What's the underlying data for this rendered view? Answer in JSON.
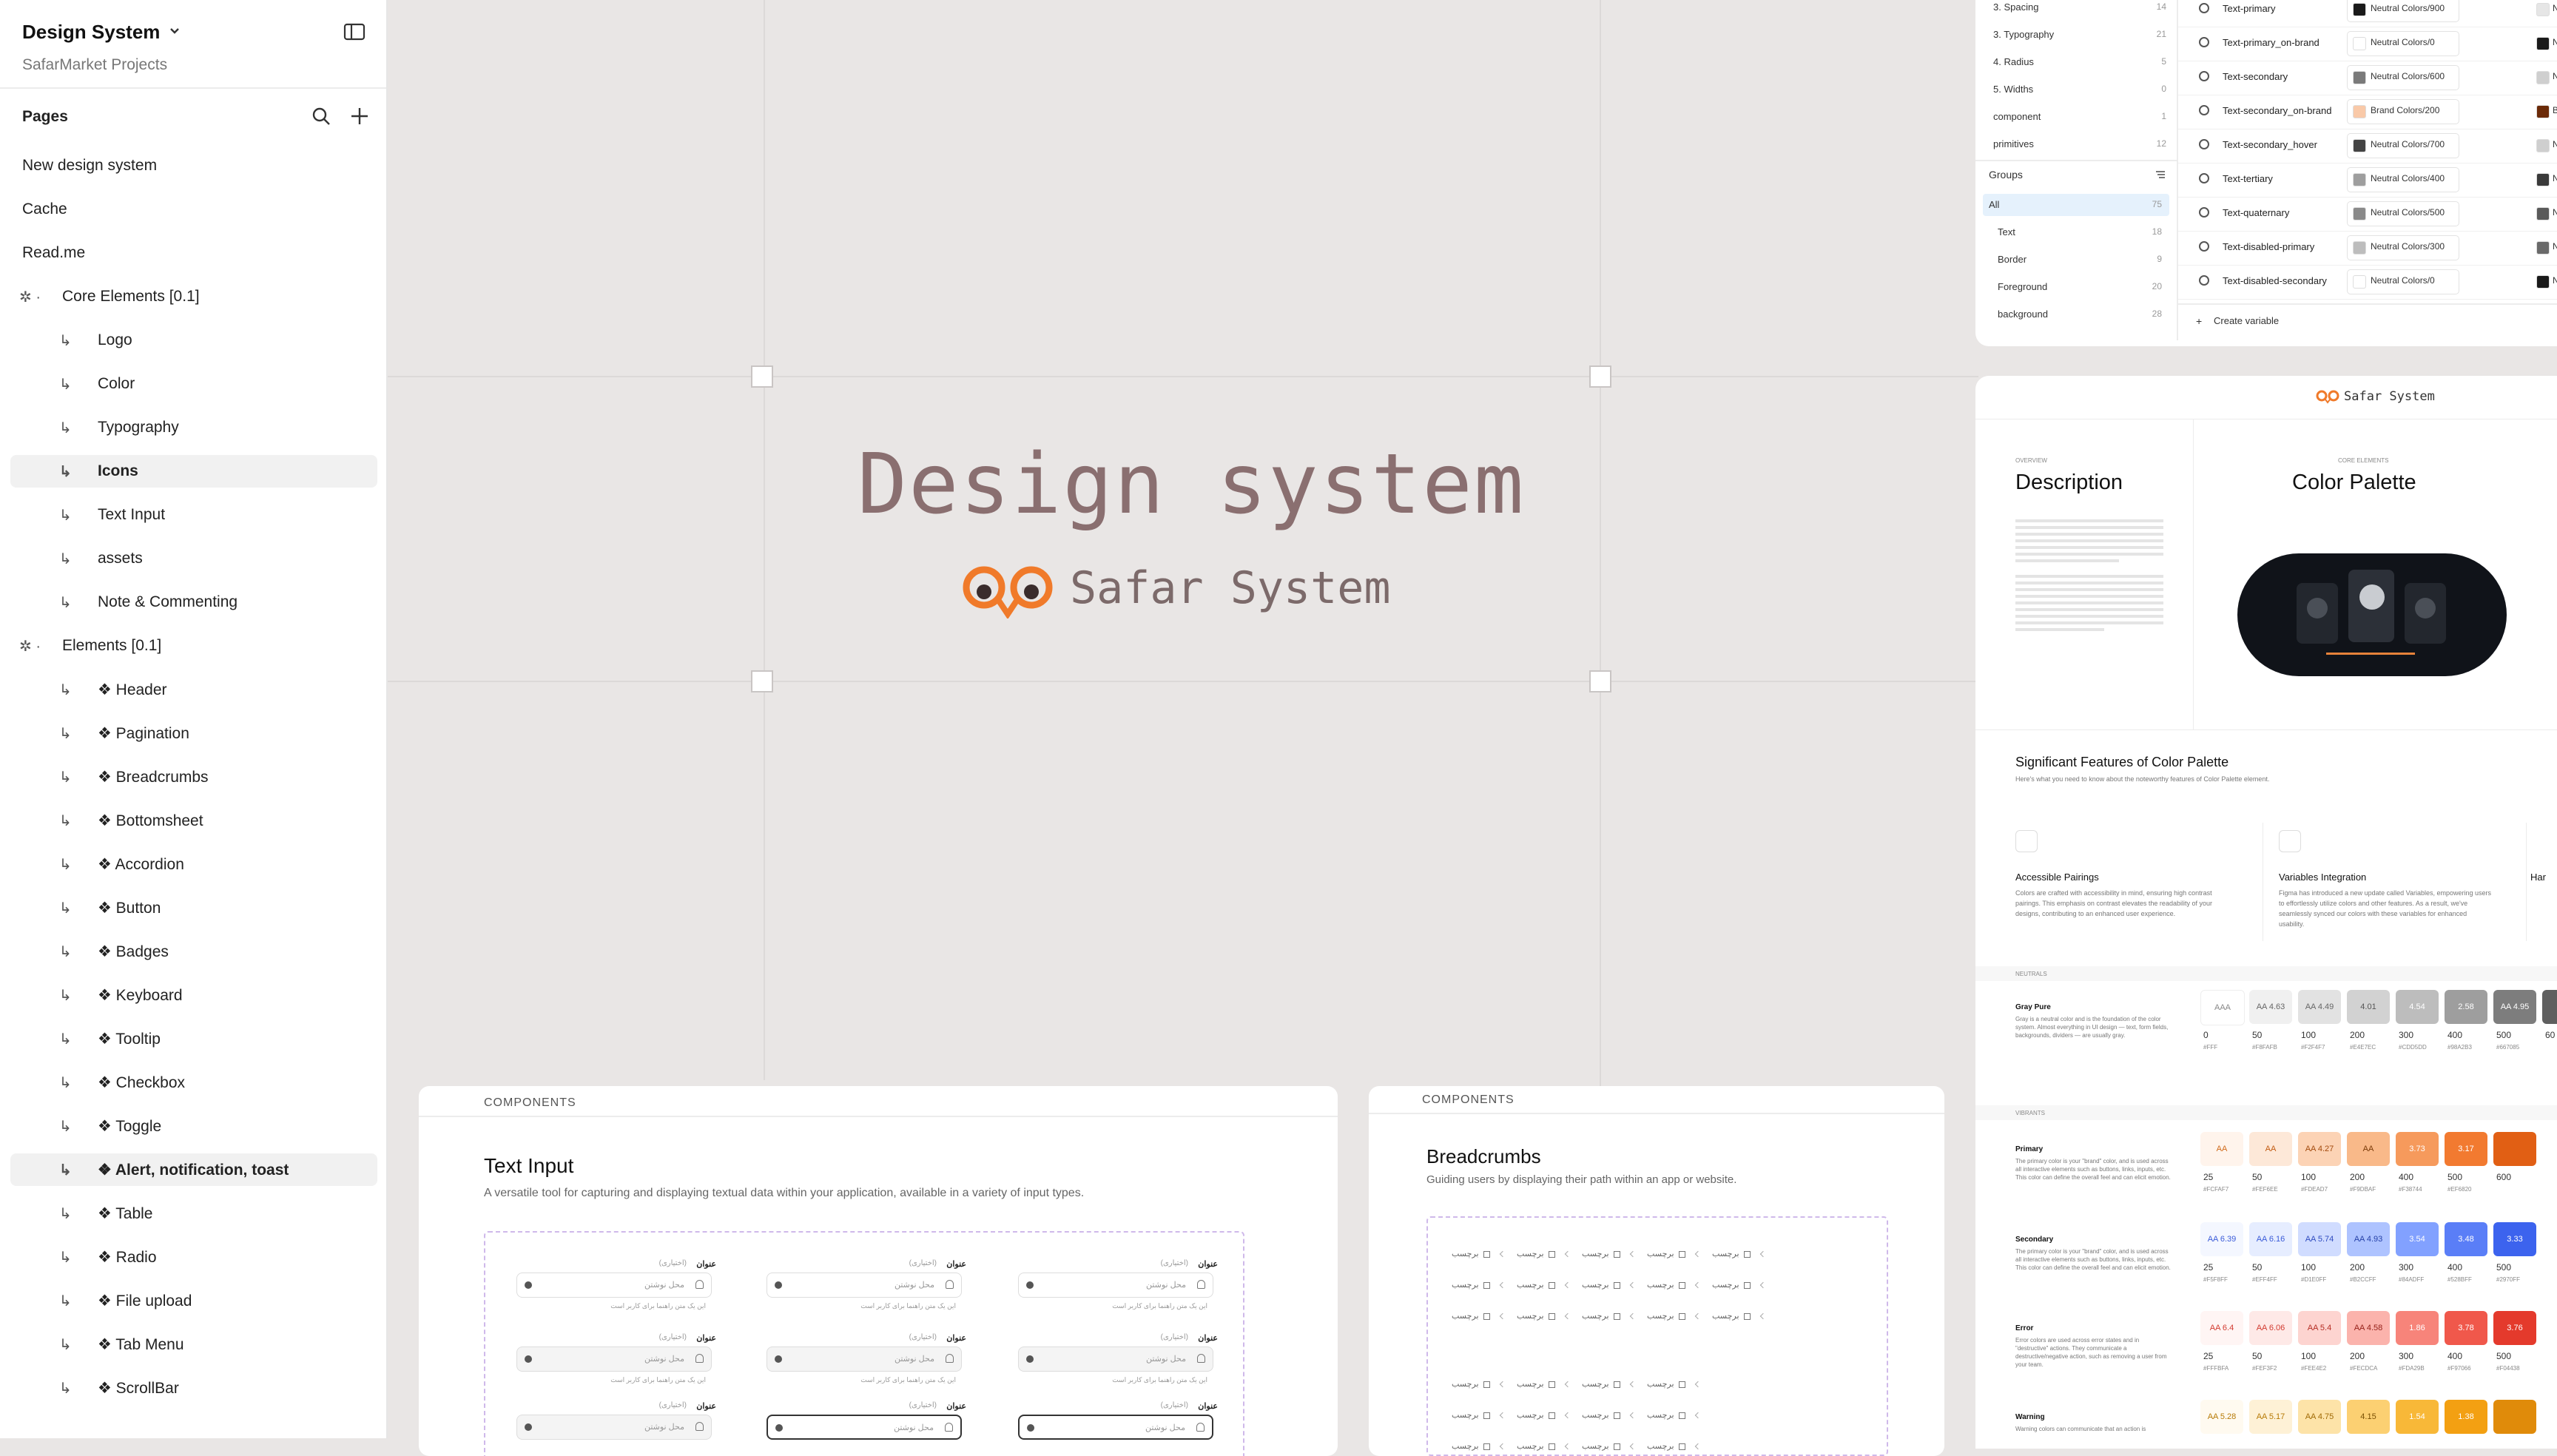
{
  "sidebar": {
    "file_title": "Design System",
    "project": "SafarMarket Projects",
    "pages_label": "Pages",
    "pages": [
      {
        "label": "New design system",
        "prefix": ""
      },
      {
        "label": "Cache",
        "prefix": ""
      },
      {
        "label": "Read.me",
        "prefix": ""
      },
      {
        "label": "Core Elements [0.1]",
        "prefix": "✲ ·"
      },
      {
        "label": "Logo",
        "prefix": "↳"
      },
      {
        "label": "Color",
        "prefix": "↳"
      },
      {
        "label": "Typography",
        "prefix": "↳"
      },
      {
        "label": "Icons",
        "prefix": "↳"
      },
      {
        "label": "Text Input",
        "prefix": "↳"
      },
      {
        "label": "assets",
        "prefix": "↳"
      },
      {
        "label": "Note & Commenting",
        "prefix": "↳"
      },
      {
        "label": "Elements [0.1]",
        "prefix": "✲ ·"
      },
      {
        "label": "❖ Header",
        "prefix": "↳"
      },
      {
        "label": "❖ Pagination",
        "prefix": "↳"
      },
      {
        "label": "❖ Breadcrumbs",
        "prefix": "↳"
      },
      {
        "label": "❖ Bottomsheet",
        "prefix": "↳"
      },
      {
        "label": "❖ Accordion",
        "prefix": "↳"
      },
      {
        "label": "❖ Button",
        "prefix": "↳"
      },
      {
        "label": "❖ Badges",
        "prefix": "↳"
      },
      {
        "label": "❖ Keyboard",
        "prefix": "↳"
      },
      {
        "label": "❖ Tooltip",
        "prefix": "↳"
      },
      {
        "label": "❖ Checkbox",
        "prefix": "↳"
      },
      {
        "label": "❖ Toggle",
        "prefix": "↳"
      },
      {
        "label": "❖ Alert, notification, toast",
        "prefix": "↳"
      },
      {
        "label": "❖ Table",
        "prefix": "↳"
      },
      {
        "label": "❖ Radio",
        "prefix": "↳"
      },
      {
        "label": "❖ File upload",
        "prefix": "↳"
      },
      {
        "label": "❖ Tab Menu",
        "prefix": "↳"
      },
      {
        "label": "❖ ScrollBar",
        "prefix": "↳"
      }
    ]
  },
  "hero": {
    "title": "Design system",
    "brand": "Safar System"
  },
  "variables_panel": {
    "collections": [
      {
        "name": "3. Spacing",
        "count": "14"
      },
      {
        "name": "3. Typography",
        "count": "21"
      },
      {
        "name": "4. Radius",
        "count": "5"
      },
      {
        "name": "5. Widths",
        "count": "0"
      },
      {
        "name": "component",
        "count": "1"
      },
      {
        "name": "primitives",
        "count": "12"
      }
    ],
    "groups_label": "Groups",
    "groups": [
      {
        "name": "All",
        "count": "75"
      },
      {
        "name": "Text",
        "count": "18"
      },
      {
        "name": "Border",
        "count": "9"
      },
      {
        "name": "Foreground",
        "count": "20"
      },
      {
        "name": "background",
        "count": "28"
      }
    ],
    "variables": [
      {
        "name": "Text-primary",
        "value": "Neutral Colors/900",
        "color": "#1a1a1a",
        "next": "#e6e6e6"
      },
      {
        "name": "Text-primary_on-brand",
        "value": "Neutral Colors/0",
        "color": "#ffffff",
        "next": "#1a1a1a"
      },
      {
        "name": "Text-secondary",
        "value": "Neutral Colors/600",
        "color": "#7a7a7a",
        "next": "#cfcfcf"
      },
      {
        "name": "Text-secondary_on-brand",
        "value": "Brand Colors/200",
        "color": "#f9c9a8",
        "next": "#6b2a08"
      },
      {
        "name": "Text-secondary_hover",
        "value": "Neutral Colors/700",
        "color": "#444444",
        "next": "#cfcfcf"
      },
      {
        "name": "Text-tertiary",
        "value": "Neutral Colors/400",
        "color": "#9e9e9e",
        "next": "#3a3a3a"
      },
      {
        "name": "Text-quaternary",
        "value": "Neutral Colors/500",
        "color": "#8a8a8a",
        "next": "#5a5a5a"
      },
      {
        "name": "Text-disabled-primary",
        "value": "Neutral Colors/300",
        "color": "#bdbdbd",
        "next": "#6a6a6a"
      },
      {
        "name": "Text-disabled-secondary",
        "value": "Neutral Colors/0",
        "color": "#ffffff",
        "next": "#1a1a1a"
      }
    ],
    "next_col_prefix": "Ne",
    "next_col_brand": "Br",
    "create_label": "Create variable"
  },
  "doc_card": {
    "brand": "Safar System",
    "overview_label": "OVERVIEW",
    "description_title": "Description",
    "core_label": "CORE ELEMENTS",
    "palette_title": "Color Palette",
    "features_title": "Significant Features of Color Palette",
    "features_sub": "Here's what you need to know about the noteworthy features of Color Palette element.",
    "features": [
      {
        "title": "Accessible Pairings",
        "icon": "link-icon",
        "text": "Colors are crafted with accessibility in mind, ensuring high contrast pairings. This emphasis on contrast elevates the readability of your designs, contributing to an enhanced user experience."
      },
      {
        "title": "Variables Integration",
        "icon": "target-icon",
        "text": "Figma has introduced a new update called Variables, empowering users to effortlessly utilize colors and other features. As a result, we've seamlessly synced our colors with these variables for enhanced usability."
      },
      {
        "title": "Har",
        "icon": "",
        "text": ""
      }
    ],
    "neutrals_label": "NEUTRALS",
    "vibrants_label": "VIBRANTS",
    "rows": [
      {
        "name": "Gray Pure",
        "desc": "Gray is a neutral color and is the foundation of the color system. Almost everything in UI design — text, form fields, backgrounds, dividers — are usually gray.",
        "chips": [
          {
            "bg": "#ffffff",
            "fg": "#888",
            "txt": "AAA",
            "step": "0",
            "hex": "#FFF"
          },
          {
            "bg": "#f0f0f0",
            "fg": "#666",
            "txt": "AA 4.63",
            "step": "50",
            "hex": "#F8FAFB"
          },
          {
            "bg": "#e2e2e2",
            "fg": "#666",
            "txt": "AA 4.49",
            "step": "100",
            "hex": "#F2F4F7"
          },
          {
            "bg": "#d2d2d2",
            "fg": "#555",
            "txt": "4.01",
            "step": "200",
            "hex": "#E4E7EC"
          },
          {
            "bg": "#bdbdbd",
            "fg": "#fff",
            "txt": "4.54",
            "step": "300",
            "hex": "#CDD5DD"
          },
          {
            "bg": "#9e9e9e",
            "fg": "#fff",
            "txt": "2.58",
            "step": "400",
            "hex": "#98A2B3"
          },
          {
            "bg": "#7d7d7d",
            "fg": "#fff",
            "txt": "AA 4.95",
            "step": "500",
            "hex": "#667085"
          },
          {
            "bg": "#5f5f5f",
            "fg": "#fff",
            "txt": "",
            "step": "60",
            "hex": ""
          }
        ]
      },
      {
        "name": "Primary",
        "desc": "The primary color is your \"brand\" color, and is used across all interactive elements such as buttons, links, inputs, etc. This color can define the overall feel and can elicit emotion.",
        "chips": [
          {
            "bg": "#fff4ec",
            "fg": "#d06a1a",
            "txt": "AA",
            "step": "25",
            "hex": "#FCFAF7"
          },
          {
            "bg": "#fde8d8",
            "fg": "#c25a10",
            "txt": "AA",
            "step": "50",
            "hex": "#FEF6EE"
          },
          {
            "bg": "#fcd3b5",
            "fg": "#a34a0c",
            "txt": "AA 4.27",
            "step": "100",
            "hex": "#FDEAD7"
          },
          {
            "bg": "#f9b989",
            "fg": "#7a3a08",
            "txt": "AA",
            "step": "200",
            "hex": "#F9DBAF"
          },
          {
            "bg": "#f69a5c",
            "fg": "#fff",
            "txt": "3.73",
            "step": "400",
            "hex": "#F38744"
          },
          {
            "bg": "#f27a30",
            "fg": "#fff",
            "txt": "3.17",
            "step": "500",
            "hex": "#EF6820"
          },
          {
            "bg": "#e15f14",
            "fg": "#fff",
            "txt": "",
            "step": "600",
            "hex": ""
          }
        ]
      },
      {
        "name": "Secondary",
        "desc": "The primary color is your \"brand\" color, and is used across all interactive elements such as buttons, links, inputs, etc. This color can define the overall feel and can elicit emotion.",
        "chips": [
          {
            "bg": "#f4f7ff",
            "fg": "#3a5bd9",
            "txt": "AA 6.39",
            "step": "25",
            "hex": "#F5F8FF"
          },
          {
            "bg": "#e6edff",
            "fg": "#3a5bd9",
            "txt": "AA 6.16",
            "step": "50",
            "hex": "#EFF4FF"
          },
          {
            "bg": "#d0dcff",
            "fg": "#2e4bc0",
            "txt": "AA 5.74",
            "step": "100",
            "hex": "#D1E0FF"
          },
          {
            "bg": "#aec3ff",
            "fg": "#2540a8",
            "txt": "AA 4.93",
            "step": "200",
            "hex": "#B2CCFF"
          },
          {
            "bg": "#82a1ff",
            "fg": "#fff",
            "txt": "3.54",
            "step": "300",
            "hex": "#84ADFF"
          },
          {
            "bg": "#5a7ef7",
            "fg": "#fff",
            "txt": "3.48",
            "step": "400",
            "hex": "#528BFF"
          },
          {
            "bg": "#3c63ee",
            "fg": "#fff",
            "txt": "3.33",
            "step": "500",
            "hex": "#2970FF"
          }
        ]
      },
      {
        "name": "Error",
        "desc": "Error colors are used across error states and in \"destructive\" actions. They communicate a destructive/negative action, such as removing a user from your team.",
        "chips": [
          {
            "bg": "#fff5f4",
            "fg": "#d23a2f",
            "txt": "AA 6.4",
            "step": "25",
            "hex": "#FFFBFA"
          },
          {
            "bg": "#fee9e7",
            "fg": "#d23a2f",
            "txt": "AA 6.06",
            "step": "50",
            "hex": "#FEF3F2"
          },
          {
            "bg": "#fdd4d0",
            "fg": "#b52d23",
            "txt": "AA 5.4",
            "step": "100",
            "hex": "#FEE4E2"
          },
          {
            "bg": "#fbb3ac",
            "fg": "#962119",
            "txt": "AA 4.58",
            "step": "200",
            "hex": "#FECDCA"
          },
          {
            "bg": "#f7847a",
            "fg": "#fff",
            "txt": "1.86",
            "step": "300",
            "hex": "#FDA29B"
          },
          {
            "bg": "#f0584b",
            "fg": "#fff",
            "txt": "3.78",
            "step": "400",
            "hex": "#F97066"
          },
          {
            "bg": "#e43a2c",
            "fg": "#fff",
            "txt": "3.76",
            "step": "500",
            "hex": "#F04438"
          }
        ]
      },
      {
        "name": "Warning",
        "desc": "Warning colors can communicate that an action is",
        "chips": [
          {
            "bg": "#fffaf0",
            "fg": "#b77a05",
            "txt": "AA 5.28",
            "step": "",
            "hex": ""
          },
          {
            "bg": "#fef1d6",
            "fg": "#b77a05",
            "txt": "AA 5.17",
            "step": "",
            "hex": ""
          },
          {
            "bg": "#fde3a8",
            "fg": "#a06a05",
            "txt": "AA 4.75",
            "step": "",
            "hex": ""
          },
          {
            "bg": "#fcd072",
            "fg": "#7a5004",
            "txt": "4.15",
            "step": "",
            "hex": ""
          },
          {
            "bg": "#f8b838",
            "fg": "#fff",
            "txt": "1.54",
            "step": "",
            "hex": ""
          },
          {
            "bg": "#f3a012",
            "fg": "#fff",
            "txt": "1.38",
            "step": "",
            "hex": ""
          },
          {
            "bg": "#e08b0a",
            "fg": "#fff",
            "txt": "",
            "step": "",
            "hex": ""
          }
        ]
      }
    ]
  },
  "text_input_card": {
    "section": "COMPONENTS",
    "title": "Text Input",
    "desc": "A versatile tool for capturing and displaying textual data within your application, available in a variety of input types.",
    "field_label": "عنوان",
    "field_optional": "(اختیاری)",
    "field_placeholder": "محل نوشتن",
    "field_hint": "این یک متن راهنما برای کاربر است"
  },
  "breadcrumbs_card": {
    "section": "COMPONENTS",
    "title": "Breadcrumbs",
    "desc": "Guiding users by displaying their path within an app or website.",
    "crumb": "برچسب"
  },
  "colors": {
    "brand": "#f07a2a",
    "hero_text": "#8a6f70",
    "canvas": "#e9e6e5"
  }
}
